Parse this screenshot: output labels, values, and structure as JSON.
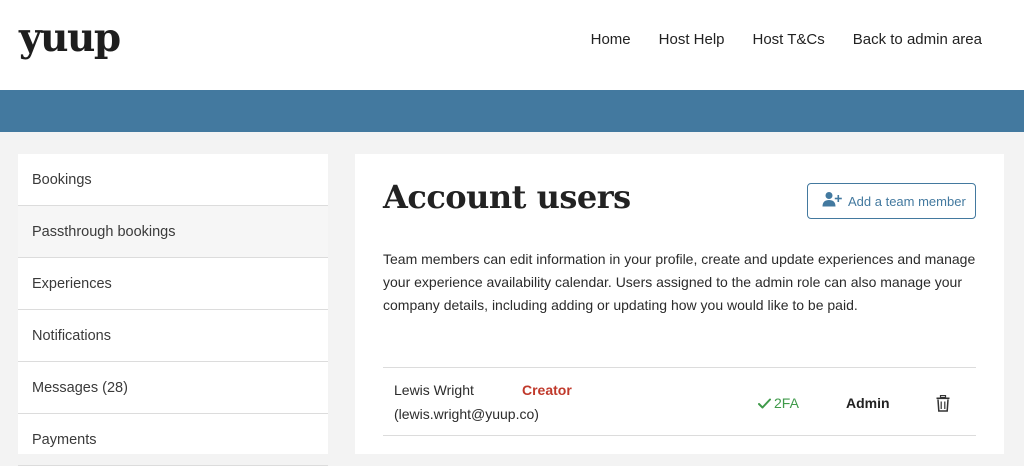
{
  "brand": {
    "logo_text": "yuup"
  },
  "top_nav": {
    "items": [
      {
        "label": "Home"
      },
      {
        "label": "Host Help"
      },
      {
        "label": "Host T&Cs"
      },
      {
        "label": "Back to admin area"
      }
    ]
  },
  "colors": {
    "banner": "#43799f",
    "accent": "#43799f",
    "creator": "#c0392b",
    "success": "#3f9a4a"
  },
  "sidebar": {
    "items": [
      {
        "label": "Bookings"
      },
      {
        "label": "Passthrough bookings",
        "active": true
      },
      {
        "label": "Experiences"
      },
      {
        "label": "Notifications"
      },
      {
        "label": "Messages (28)"
      },
      {
        "label": "Payments"
      }
    ]
  },
  "main": {
    "title": "Account users",
    "add_button": {
      "label": "Add a team member",
      "icon": "add-user-icon"
    },
    "description": "Team members can edit information in your profile, create and update experiences and manage your experience availability calendar. Users assigned to the admin role can also manage your company details, including adding or updating how you would like to be paid.",
    "users": [
      {
        "name": "Lewis Wright",
        "email": "(lewis.wright@yuup.co)",
        "badge": "Creator",
        "twofa": "2FA",
        "role": "Admin",
        "delete_icon": "trash-icon"
      }
    ]
  }
}
